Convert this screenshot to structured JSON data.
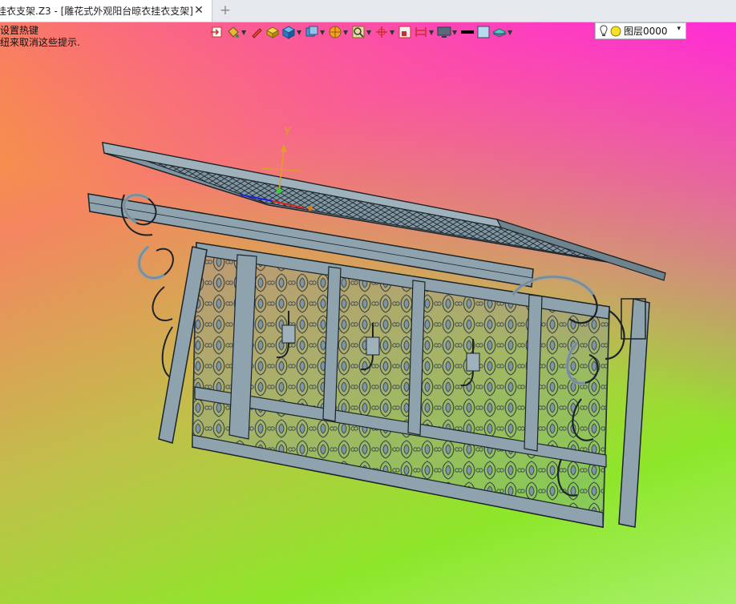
{
  "tab": {
    "title": "挂衣支架.Z3 - [雕花式外观阳台晾衣挂衣支架]",
    "close_glyph": "✕",
    "new_tab_glyph": "+"
  },
  "hint": {
    "line1": "设置热键",
    "line2": "纽来取消这些提示."
  },
  "toolbar": {
    "icons": [
      "exit-sketch-icon",
      "paint-bucket-icon",
      "pencil-icon",
      "yellow-solid-icon",
      "blue-cube-icon",
      "view-cube-icon",
      "pie-render-icon",
      "zoom-box-icon",
      "axis-marker-icon",
      "section-view-icon",
      "bracket-dim-icon",
      "monitor-icon",
      "line-color-icon",
      "fill-color-icon",
      "layer-stack-icon"
    ]
  },
  "layer": {
    "name": "图层0000",
    "caret": "▾"
  },
  "axis": {
    "y_label": "Y"
  },
  "colors": {
    "model_fill": "#7f96a2",
    "model_edge": "#1c2328",
    "tab_bg": "#ffffff",
    "bulb_yellow": "#f5e224"
  }
}
